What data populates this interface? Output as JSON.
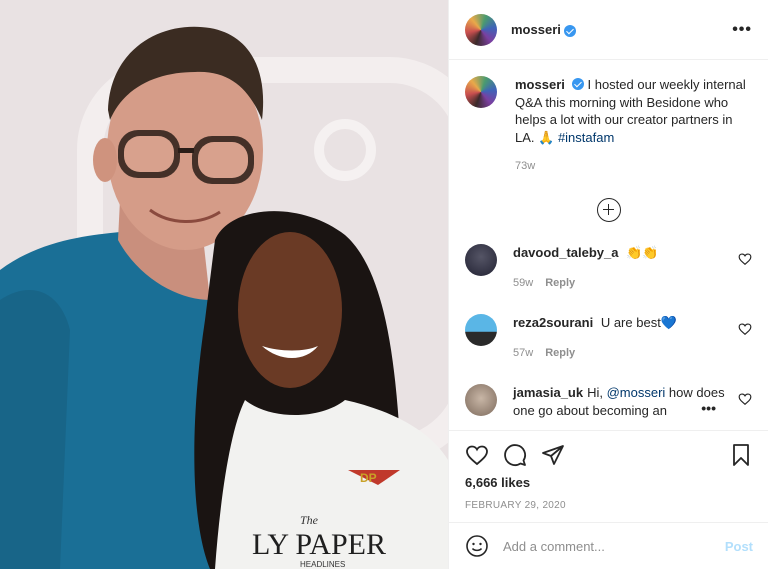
{
  "header": {
    "username": "mosseri",
    "more_label": "•••"
  },
  "caption": {
    "username": "mosseri",
    "text": "I hosted our weekly internal Q&A this morning with Besidone who helps a lot with our creator partners in LA. 🙏",
    "hashtag": "#instafam",
    "age": "73w"
  },
  "comments": [
    {
      "username": "davood_taleby_a",
      "text": "👏👏",
      "age": "59w",
      "reply_label": "Reply"
    },
    {
      "username": "reza2sourani",
      "text": "U are best💙",
      "age": "57w",
      "reply_label": "Reply"
    },
    {
      "username": "jamasia_uk",
      "text_prefix": "Hi, ",
      "mention": "@mosseri",
      "text_suffix": " how does one go about becoming an",
      "ellipsis": "•••"
    }
  ],
  "actions": {
    "likes": "6,666 likes",
    "date": "FEBRUARY 29, 2020"
  },
  "composer": {
    "placeholder": "Add a comment...",
    "post_label": "Post"
  },
  "photo": {
    "shirt_text_top": "The",
    "shirt_text_main": "LY PAPER",
    "shirt_text_bottom": "HEADLINES",
    "logo_text": "DP"
  },
  "colors": {
    "accent": "#3897f0",
    "post_disabled": "#b2dffc",
    "link": "#00376b"
  }
}
